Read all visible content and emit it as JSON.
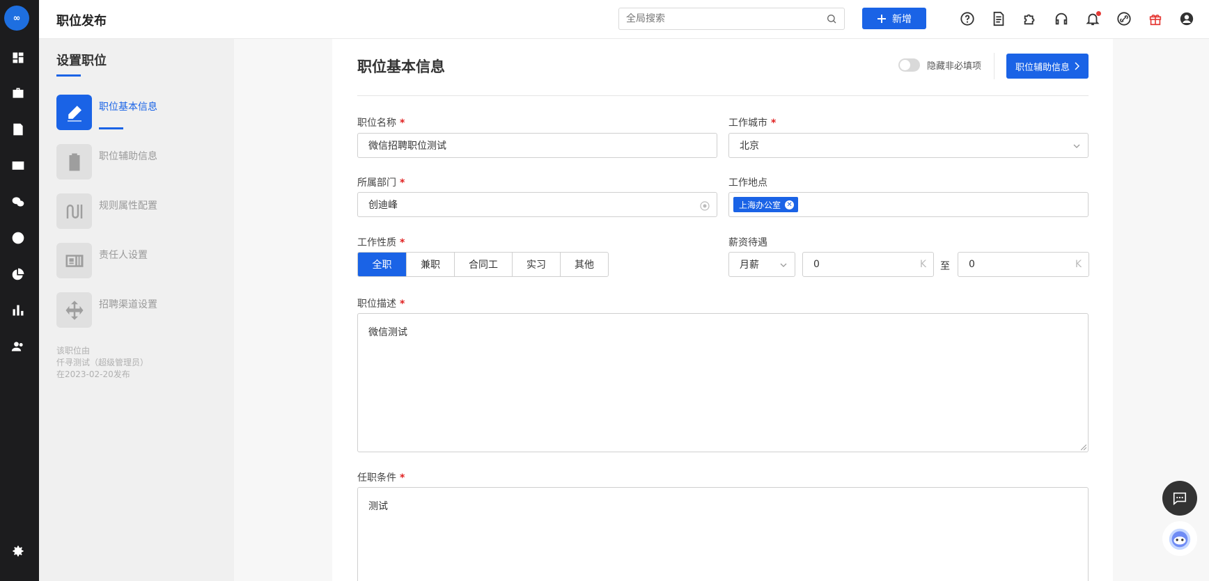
{
  "app": {
    "logo_text": "∞",
    "page_title": "职位发布"
  },
  "topbar": {
    "search_placeholder": "全局搜索",
    "add_label": "新增",
    "icons": [
      "help-icon",
      "document-icon",
      "plugin-icon",
      "headset-icon",
      "bell-icon",
      "link-icon",
      "gift-icon",
      "user-icon"
    ],
    "accent": "#1a63e6"
  },
  "rail": {
    "icons": [
      "dashboard-icon",
      "briefcase-icon",
      "resume-icon",
      "id-card-icon",
      "wechat-icon",
      "like-icon",
      "pie-chart-icon",
      "bar-chart-icon",
      "team-icon",
      "settings-icon"
    ]
  },
  "steps": {
    "title": "设置职位",
    "items": [
      {
        "label": "职位基本信息",
        "icon": "edit-icon",
        "active": true
      },
      {
        "label": "职位辅助信息",
        "icon": "clipboard-icon",
        "active": false
      },
      {
        "label": "规则属性配置",
        "icon": "rule-icon",
        "active": false
      },
      {
        "label": "责任人设置",
        "icon": "contact-card-icon",
        "active": false
      },
      {
        "label": "招聘渠道设置",
        "icon": "move-icon",
        "active": false
      }
    ],
    "note": [
      "该职位由",
      "仟寻测试（超级管理员）",
      "在2023-02-20发布"
    ]
  },
  "form": {
    "section_title": "职位基本信息",
    "hide_optional_label": "隐藏非必填项",
    "next_button": "职位辅助信息",
    "job_name": {
      "label": "职位名称",
      "value": "微信招聘职位测试"
    },
    "city": {
      "label": "工作城市",
      "value": "北京"
    },
    "department": {
      "label": "所属部门",
      "value": "创迪峰"
    },
    "location": {
      "label": "工作地点",
      "tag": "上海办公室"
    },
    "job_type": {
      "label": "工作性质",
      "options": [
        "全职",
        "兼职",
        "合同工",
        "实习",
        "其他"
      ],
      "selected": "全职"
    },
    "salary": {
      "label": "薪资待遇",
      "period": "月薪",
      "min": "0",
      "max": "0",
      "unit": "K",
      "to": "至"
    },
    "description": {
      "label": "职位描述",
      "value": "微信测试"
    },
    "requirements": {
      "label": "任职条件",
      "value": "测试"
    },
    "required_mark": "*"
  }
}
